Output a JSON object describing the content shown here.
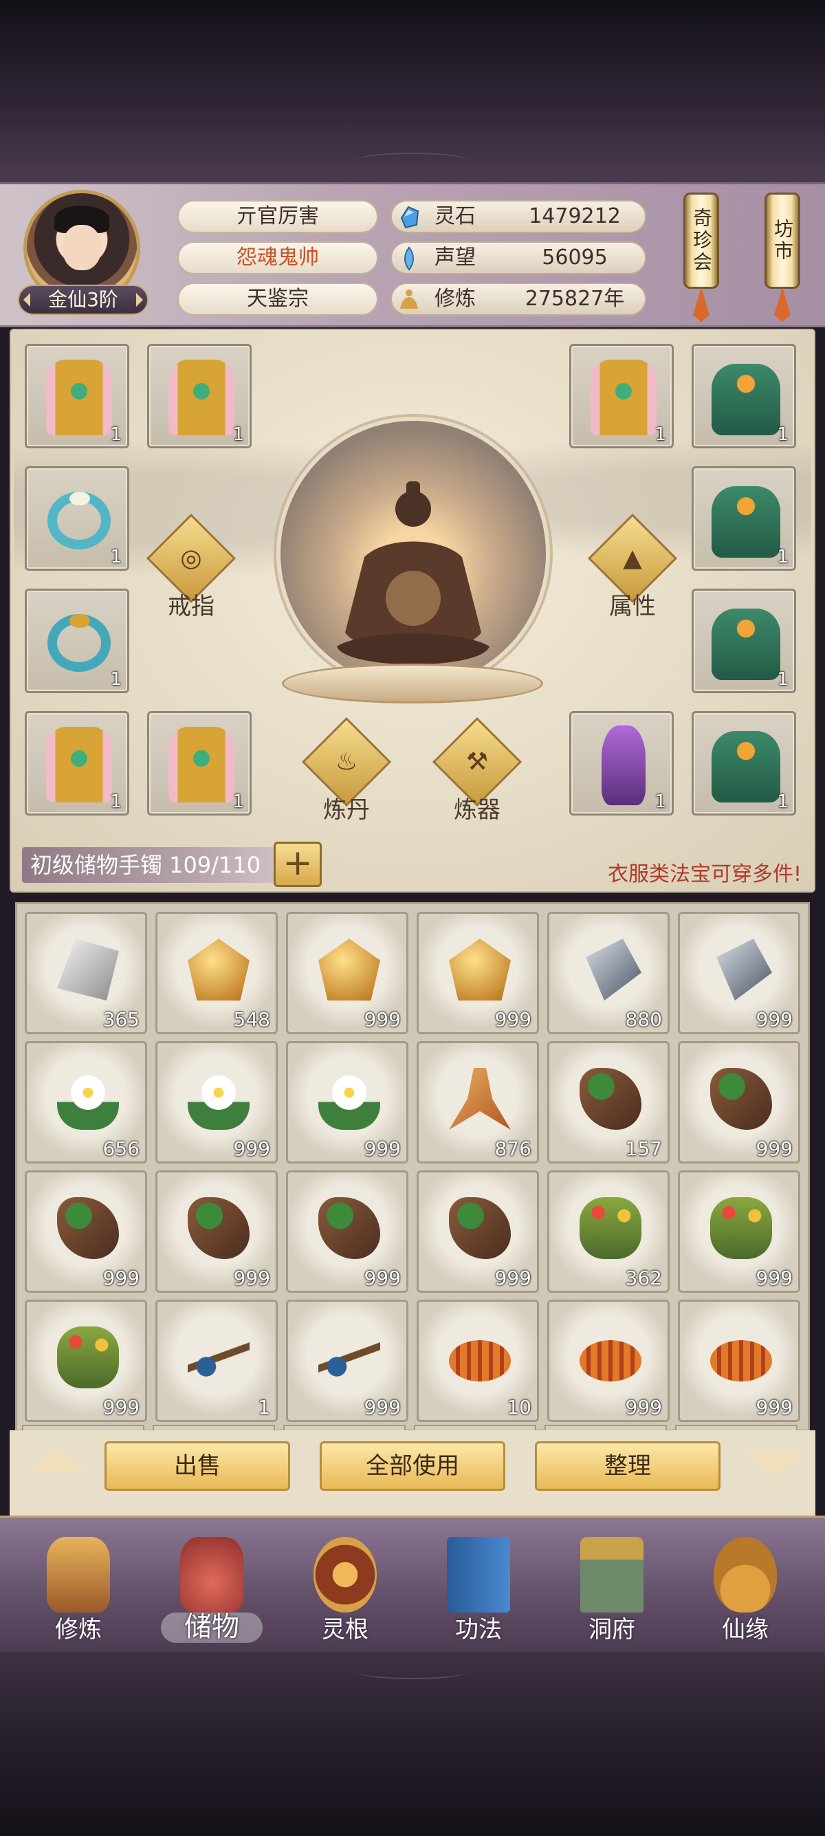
{
  "header": {
    "rank": "金仙3阶",
    "names": [
      "亓官厉害",
      "怨魂鬼帅",
      "天鉴宗"
    ],
    "resources": [
      {
        "label": "灵石",
        "value": "1479212",
        "icon": "spirit-stone-icon",
        "color": "#4aa0e0"
      },
      {
        "label": "声望",
        "value": "56095",
        "icon": "prestige-crystal-icon",
        "color": "#6ab0e8"
      },
      {
        "label": "修炼",
        "value": "275827年",
        "icon": "meditation-icon",
        "color": "#d9a04a"
      }
    ],
    "scrolls": [
      "奇珍会",
      "坊市"
    ]
  },
  "equipment": {
    "left_slots": [
      {
        "icon": "gold-robe-icon",
        "count": "1"
      },
      {
        "icon": "gold-robe-icon",
        "count": "1"
      },
      {
        "icon": "ring-icon",
        "count": "1"
      },
      {
        "icon": "gold-ring-icon",
        "count": "1"
      },
      {
        "icon": "gold-robe-icon",
        "count": "1"
      },
      {
        "icon": "gold-robe-icon",
        "count": "1"
      }
    ],
    "right_slots": [
      {
        "icon": "gold-robe-icon",
        "count": "1"
      },
      {
        "icon": "green-robe-icon",
        "count": "1"
      },
      {
        "icon": "green-robe-icon",
        "count": "1"
      },
      {
        "icon": "green-robe-icon",
        "count": "1"
      },
      {
        "icon": "purple-figure-icon",
        "count": "1"
      },
      {
        "icon": "green-robe-icon",
        "count": "1"
      }
    ],
    "buttons": {
      "ring": "戒指",
      "attributes": "属性",
      "alchemy": "炼丹",
      "forging": "炼器"
    }
  },
  "storage": {
    "label": "初级储物手镯 109/110",
    "hint": "衣服类法宝可穿多件!"
  },
  "inventory": [
    {
      "icon": "silver-ore-icon",
      "count": "365"
    },
    {
      "icon": "gold-ore-icon",
      "count": "548"
    },
    {
      "icon": "gold-ore-icon",
      "count": "999"
    },
    {
      "icon": "gold-ore-icon",
      "count": "999"
    },
    {
      "icon": "steel-ore-icon",
      "count": "880"
    },
    {
      "icon": "steel-ore-icon",
      "count": "999"
    },
    {
      "icon": "white-flower-icon",
      "count": "656"
    },
    {
      "icon": "white-flower-icon",
      "count": "999"
    },
    {
      "icon": "white-flower-icon",
      "count": "999"
    },
    {
      "icon": "ginseng-root-icon",
      "count": "876"
    },
    {
      "icon": "herb-root-icon",
      "count": "157"
    },
    {
      "icon": "herb-root-icon",
      "count": "999"
    },
    {
      "icon": "herb-root-icon",
      "count": "999"
    },
    {
      "icon": "herb-root-icon",
      "count": "999"
    },
    {
      "icon": "herb-root-icon",
      "count": "999"
    },
    {
      "icon": "herb-root-icon",
      "count": "999"
    },
    {
      "icon": "flowering-herb-icon",
      "count": "362"
    },
    {
      "icon": "flowering-herb-icon",
      "count": "999"
    },
    {
      "icon": "flowering-herb-icon",
      "count": "999"
    },
    {
      "icon": "berry-branch-icon",
      "count": "1"
    },
    {
      "icon": "berry-branch-icon",
      "count": "999"
    },
    {
      "icon": "cordyceps-icon",
      "count": "10"
    },
    {
      "icon": "cordyceps-icon",
      "count": "999"
    },
    {
      "icon": "cordyceps-icon",
      "count": "999"
    }
  ],
  "actions": {
    "sell": "出售",
    "use_all": "全部使用",
    "sort": "整理"
  },
  "nav": [
    {
      "label": "修炼",
      "icon": "cultivate-icon"
    },
    {
      "label": "储物",
      "icon": "storage-bag-icon",
      "active": true
    },
    {
      "label": "灵根",
      "icon": "spirit-root-icon"
    },
    {
      "label": "功法",
      "icon": "technique-book-icon"
    },
    {
      "label": "洞府",
      "icon": "cave-mansion-icon"
    },
    {
      "label": "仙缘",
      "icon": "fortune-gourd-icon"
    }
  ]
}
